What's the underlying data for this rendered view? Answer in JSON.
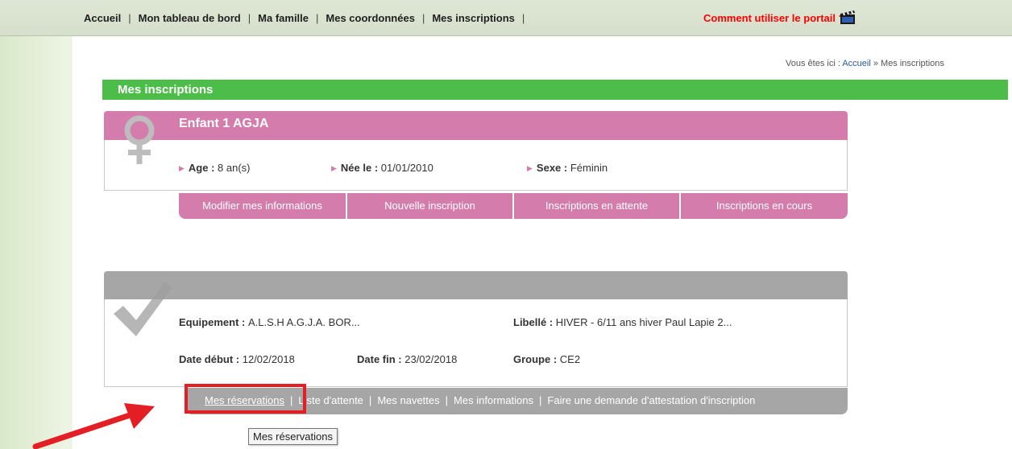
{
  "nav": {
    "items": [
      "Accueil",
      "Mon tableau de bord",
      "Ma famille",
      "Mes coordonnées",
      "Mes inscriptions"
    ],
    "help": "Comment utiliser le portail ?"
  },
  "breadcrumb": {
    "prefix": "Vous êtes ici : ",
    "home": "Accueil",
    "separator": " » ",
    "current": "Mes inscriptions"
  },
  "section_title": "Mes inscriptions",
  "child": {
    "name": "Enfant 1 AGJA",
    "age_label": "Age : ",
    "age_value": "8 an(s)",
    "born_label": "Née le : ",
    "born_value": "01/01/2010",
    "sex_label": "Sexe : ",
    "sex_value": "Féminin",
    "tabs": [
      "Modifier mes informations",
      "Nouvelle inscription",
      "Inscriptions en attente",
      "Inscriptions en cours"
    ]
  },
  "inscription": {
    "equipment_label": "Equipement : ",
    "equipment_value": "A.L.S.H A.G.J.A. BOR...",
    "libelle_label": "Libellé : ",
    "libelle_value": "HIVER - 6/11 ans hiver Paul Lapie 2...",
    "start_label": "Date début : ",
    "start_value": "12/02/2018",
    "end_label": "Date fin : ",
    "end_value": "23/02/2018",
    "group_label": "Groupe : ",
    "group_value": "CE2",
    "links": [
      "Mes réservations",
      "Liste d'attente",
      "Mes navettes",
      "Mes informations",
      "Faire une demande d'attestation d'inscription"
    ],
    "link_separator": "|"
  },
  "tooltip": "Mes réservations",
  "icons": {
    "help": "clapperboard-icon",
    "child": "female-symbol-icon",
    "inscription": "checkmark-icon",
    "annotation": "red-arrow-icon",
    "info_bullet": "triangle-bullet-icon"
  },
  "colors": {
    "accent_green": "#4dbd4a",
    "child_pink": "#d47cab",
    "inscription_gray": "#a6a6a6",
    "help_red": "#ff0000",
    "highlight_red": "#e41e25"
  }
}
